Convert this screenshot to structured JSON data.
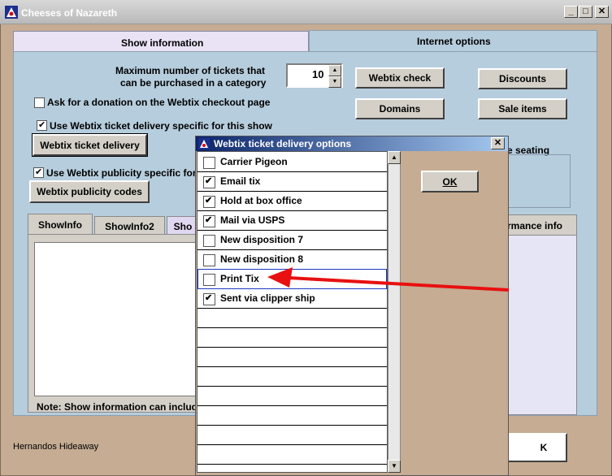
{
  "window": {
    "title": "Cheeses of Nazareth"
  },
  "main_tabs": [
    {
      "label": "Show information"
    },
    {
      "label": "Internet options"
    }
  ],
  "tickets": {
    "label_line1": "Maximum number of tickets that",
    "label_line2": "can be purchased in a category",
    "value": "10"
  },
  "buttons": {
    "webtix_check": "Webtix check",
    "discounts": "Discounts",
    "domains": "Domains",
    "sale_items": "Sale items",
    "webtix_ticket_delivery": "Webtix ticket delivery",
    "webtix_publicity_codes": "Webtix publicity codes"
  },
  "checkboxes": {
    "donation": {
      "label": "Ask for a donation on the Webtix checkout page",
      "checked": false
    },
    "delivery": {
      "label": "Use Webtix ticket delivery specific for this show",
      "checked": true
    },
    "publicity": {
      "label": "Use Webtix publicity specific for",
      "checked": true
    }
  },
  "seating_label": "e seating",
  "sub_tabs": [
    {
      "label": "ShowInfo"
    },
    {
      "label": "ShowInfo2"
    },
    {
      "label": "Sho"
    }
  ],
  "perf_tab_label": "rmance info",
  "note": "Note: Show information can includ",
  "footer": {
    "venue": "Hernandos Hideaway",
    "ok_partial": "K"
  },
  "dialog": {
    "title": "Webtix ticket delivery options",
    "close": "✕",
    "ok": "OK",
    "items": [
      {
        "label": "Carrier Pigeon",
        "checked": false
      },
      {
        "label": "Email tix",
        "checked": true
      },
      {
        "label": "Hold at box office",
        "checked": true
      },
      {
        "label": "Mail via USPS",
        "checked": true
      },
      {
        "label": "New disposition 7",
        "checked": false
      },
      {
        "label": "New disposition 8",
        "checked": false
      },
      {
        "label": "Print Tix",
        "checked": false
      },
      {
        "label": "Sent via clipper ship",
        "checked": true
      }
    ]
  },
  "annotation": {
    "arrow_color": "#e81010"
  },
  "colors": {
    "panel": "#b6cddd",
    "window_bg": "#c5ac93",
    "dialog_title": "#0a246a"
  }
}
